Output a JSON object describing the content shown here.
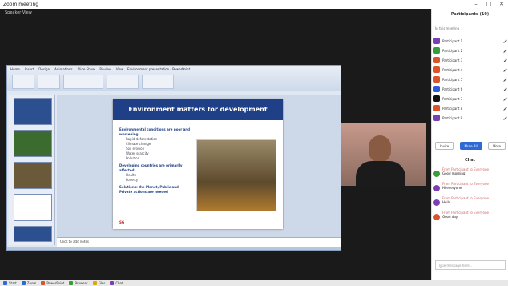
{
  "window": {
    "title": "Zoom meeting",
    "controls": [
      "–",
      "▢",
      "✕"
    ]
  },
  "meeting": {
    "view_label": "Speaker View"
  },
  "presentation": {
    "tabs": [
      "Home",
      "Insert",
      "Design",
      "Animations",
      "Slide Show",
      "Review",
      "View"
    ],
    "doc_title": "Environment presentation - PowerPoint",
    "slide_title": "Environment matters for development",
    "bullets": [
      {
        "text": "Environmental conditions are poor and worsening",
        "subs": [
          "Rapid deforestation",
          "Climate change",
          "Soil erosion",
          "Water scarcity",
          "Pollution"
        ]
      },
      {
        "text": "Developing countries are primarily affected",
        "subs": [
          "Health",
          "Poverty"
        ]
      },
      {
        "text": "Solutions: the Planet, Public and Private actions are needed",
        "subs": []
      }
    ],
    "footer": "SG",
    "notes": "Click to add notes"
  },
  "participants_panel": {
    "title": "Participants (10)",
    "subtitle": "In this meeting",
    "participants": [
      {
        "name": "Participant 1",
        "color": "#7a3fb0"
      },
      {
        "name": "Participant 2",
        "color": "#3a9b3a"
      },
      {
        "name": "Participant 3",
        "color": "#d9542b"
      },
      {
        "name": "Participant 4",
        "color": "#d9542b"
      },
      {
        "name": "Participant 5",
        "color": "#d9542b"
      },
      {
        "name": "Participant 6",
        "color": "#2d5bd6"
      },
      {
        "name": "Participant 7",
        "color": "#111111"
      },
      {
        "name": "Participant 8",
        "color": "#d9542b"
      },
      {
        "name": "Participant 9",
        "color": "#7a3fb0"
      }
    ],
    "buttons": {
      "invite": "Invite",
      "mute_all": "Mute All",
      "more": "More"
    }
  },
  "chat": {
    "title": "Chat",
    "messages": [
      {
        "from": "From Participant to Everyone",
        "body": "Good morning",
        "color": "#3a9b3a"
      },
      {
        "from": "From Participant to Everyone",
        "body": "Hi everyone",
        "color": "#7a3fb0"
      },
      {
        "from": "From Participant to Everyone",
        "body": "Hello",
        "color": "#7a3fb0"
      },
      {
        "from": "From Participant to Everyone",
        "body": "Good day",
        "color": "#d9542b"
      }
    ],
    "input_placeholder": "Type message here..."
  },
  "taskbar": {
    "items": [
      {
        "label": "Start",
        "color": "#2d6ad6"
      },
      {
        "label": "Zoom",
        "color": "#2d6ad6"
      },
      {
        "label": "PowerPoint",
        "color": "#d9542b"
      },
      {
        "label": "Browser",
        "color": "#3a9b3a"
      },
      {
        "label": "Files",
        "color": "#e0a800"
      },
      {
        "label": "Chat",
        "color": "#7a3fb0"
      }
    ]
  }
}
